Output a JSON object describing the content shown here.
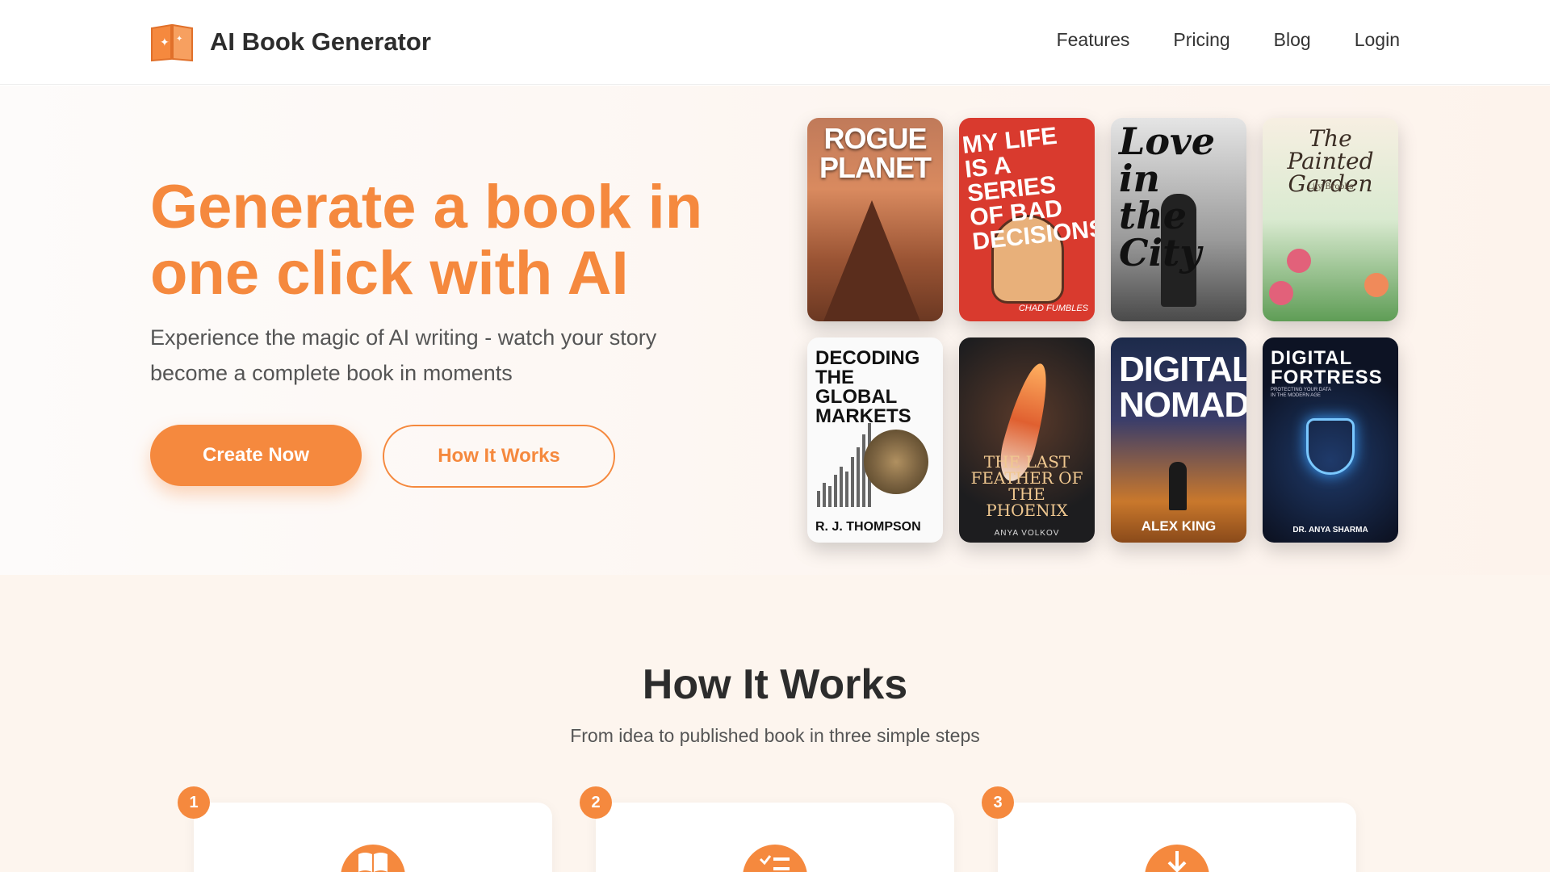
{
  "header": {
    "brand": "AI Book Generator",
    "nav": [
      "Features",
      "Pricing",
      "Blog",
      "Login"
    ]
  },
  "hero": {
    "title": "Generate a book in one click with AI",
    "subtitle": "Experience the magic of AI writing - watch your story become a complete book in moments",
    "primary_button": "Create Now",
    "secondary_button": "How It Works"
  },
  "covers": [
    {
      "title": "ROGUE PLANET",
      "author": ""
    },
    {
      "title": "MY LIFE IS A SERIES OF BAD DECISIONS",
      "author": "CHAD FUMBLES"
    },
    {
      "title": "Love in the City",
      "author": ""
    },
    {
      "title": "The Painted Garden",
      "author": "Lily Brooks"
    },
    {
      "title": "DECODING THE GLOBAL MARKETS",
      "author": "R. J. THOMPSON"
    },
    {
      "title": "THE LAST FEATHER OF THE PHOENIX",
      "author": "ANYA VOLKOV"
    },
    {
      "title": "DIGITAL NOMAD",
      "author": "ALEX KING"
    },
    {
      "title": "DIGITAL FORTRESS",
      "subtitle": "PROTECTING YOUR DATA IN THE MODERN AGE",
      "author": "DR. ANYA SHARMA"
    }
  ],
  "how_it_works": {
    "title": "How It Works",
    "subtitle": "From idea to published book in three simple steps",
    "steps": [
      {
        "number": "1",
        "icon": "open-book-icon"
      },
      {
        "number": "2",
        "icon": "checklist-icon"
      },
      {
        "number": "3",
        "icon": "download-icon"
      }
    ]
  },
  "colors": {
    "accent": "#f5893e",
    "text_dark": "#2c2c2c",
    "section_bg": "#fdf5ee"
  }
}
